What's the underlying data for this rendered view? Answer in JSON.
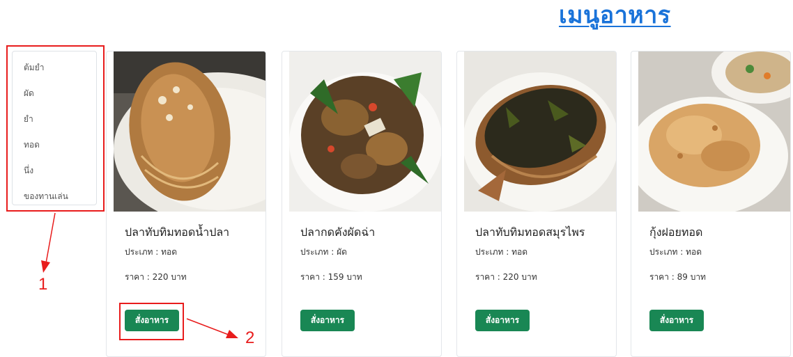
{
  "page_title": "เมนูอาหาร",
  "category_menu": {
    "items": [
      {
        "label": "ต้มยำ"
      },
      {
        "label": "ผัด"
      },
      {
        "label": "ยำ"
      },
      {
        "label": "ทอด"
      },
      {
        "label": "นึ่ง"
      },
      {
        "label": "ของทานเล่น"
      }
    ]
  },
  "menu_cards": [
    {
      "title": "ปลาทับทิมทอดน้ำปลา",
      "type": "ประเภท : ทอด",
      "price": "ราคา : 220 บาท",
      "button": "สั่งอาหาร"
    },
    {
      "title": "ปลากดคังผัดฉ่า",
      "type": "ประเภท : ผัด",
      "price": "ราคา : 159 บาท",
      "button": "สั่งอาหาร"
    },
    {
      "title": "ปลาทับทิมทอดสมุรไพร",
      "type": "ประเภท : ทอด",
      "price": "ราคา : 220 บาท",
      "button": "สั่งอาหาร"
    },
    {
      "title": "กุ้งฝอยทอด",
      "type": "ประเภท : ทอด",
      "price": "ราคา : 89 บาท",
      "button": "สั่งอาหาร"
    }
  ],
  "annotations": [
    {
      "label": "1"
    },
    {
      "label": "2"
    }
  ],
  "colors": {
    "title_link": "#1a73d9",
    "order_button": "#198754",
    "annotation": "#e81c1c"
  }
}
